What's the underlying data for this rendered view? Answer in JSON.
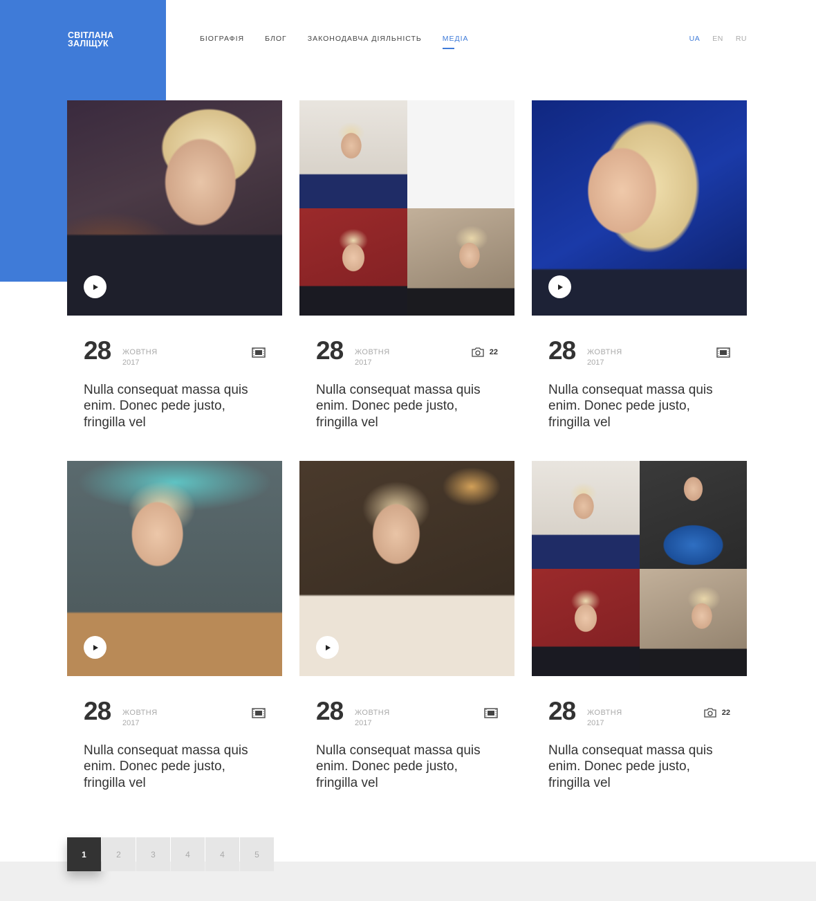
{
  "logo": {
    "line1": "СВІТЛАНА",
    "line2": "ЗАЛІЩУК"
  },
  "nav": {
    "items": [
      {
        "label": "БІОГРАФІЯ"
      },
      {
        "label": "БЛОГ"
      },
      {
        "label": "ЗАКОНОДАВЧА ДІЯЛЬНІСТЬ"
      },
      {
        "label": "МЕДІА"
      }
    ],
    "active": "МЕДІА"
  },
  "languages": {
    "items": [
      "UA",
      "EN",
      "RU"
    ],
    "active": "UA"
  },
  "colors": {
    "accent": "#3f7bd8",
    "text": "#333333",
    "muted": "#aaaaaa",
    "footer": "#efefef"
  },
  "cards": [
    {
      "type": "video",
      "icon": "film-icon",
      "day": "28",
      "month": "ЖОВТНЯ",
      "year": "2017",
      "count": "",
      "title": "Nulla consequat massa quis enim. Donec pede justo, fringilla vel"
    },
    {
      "type": "gallery",
      "icon": "camera-icon",
      "day": "28",
      "month": "ЖОВТНЯ",
      "year": "2017",
      "count": "22",
      "title": "Nulla consequat massa quis enim. Donec pede justo, fringilla vel"
    },
    {
      "type": "video",
      "icon": "film-icon",
      "day": "28",
      "month": "ЖОВТНЯ",
      "year": "2017",
      "count": "",
      "title": "Nulla consequat massa quis enim. Donec pede justo, fringilla vel"
    },
    {
      "type": "video",
      "icon": "film-icon",
      "day": "28",
      "month": "ЖОВТНЯ",
      "year": "2017",
      "count": "",
      "title": "Nulla consequat massa quis enim. Donec pede justo, fringilla vel"
    },
    {
      "type": "video",
      "icon": "film-icon",
      "day": "28",
      "month": "ЖОВТНЯ",
      "year": "2017",
      "count": "",
      "title": "Nulla consequat massa quis enim. Donec pede justo, fringilla vel"
    },
    {
      "type": "gallery",
      "icon": "camera-icon",
      "day": "28",
      "month": "ЖОВТНЯ",
      "year": "2017",
      "count": "22",
      "title": "Nulla consequat massa quis enim. Donec pede justo, fringilla vel"
    }
  ],
  "pagination": {
    "pages": [
      "1",
      "2",
      "3",
      "4",
      "4",
      "5"
    ],
    "current": "1"
  }
}
